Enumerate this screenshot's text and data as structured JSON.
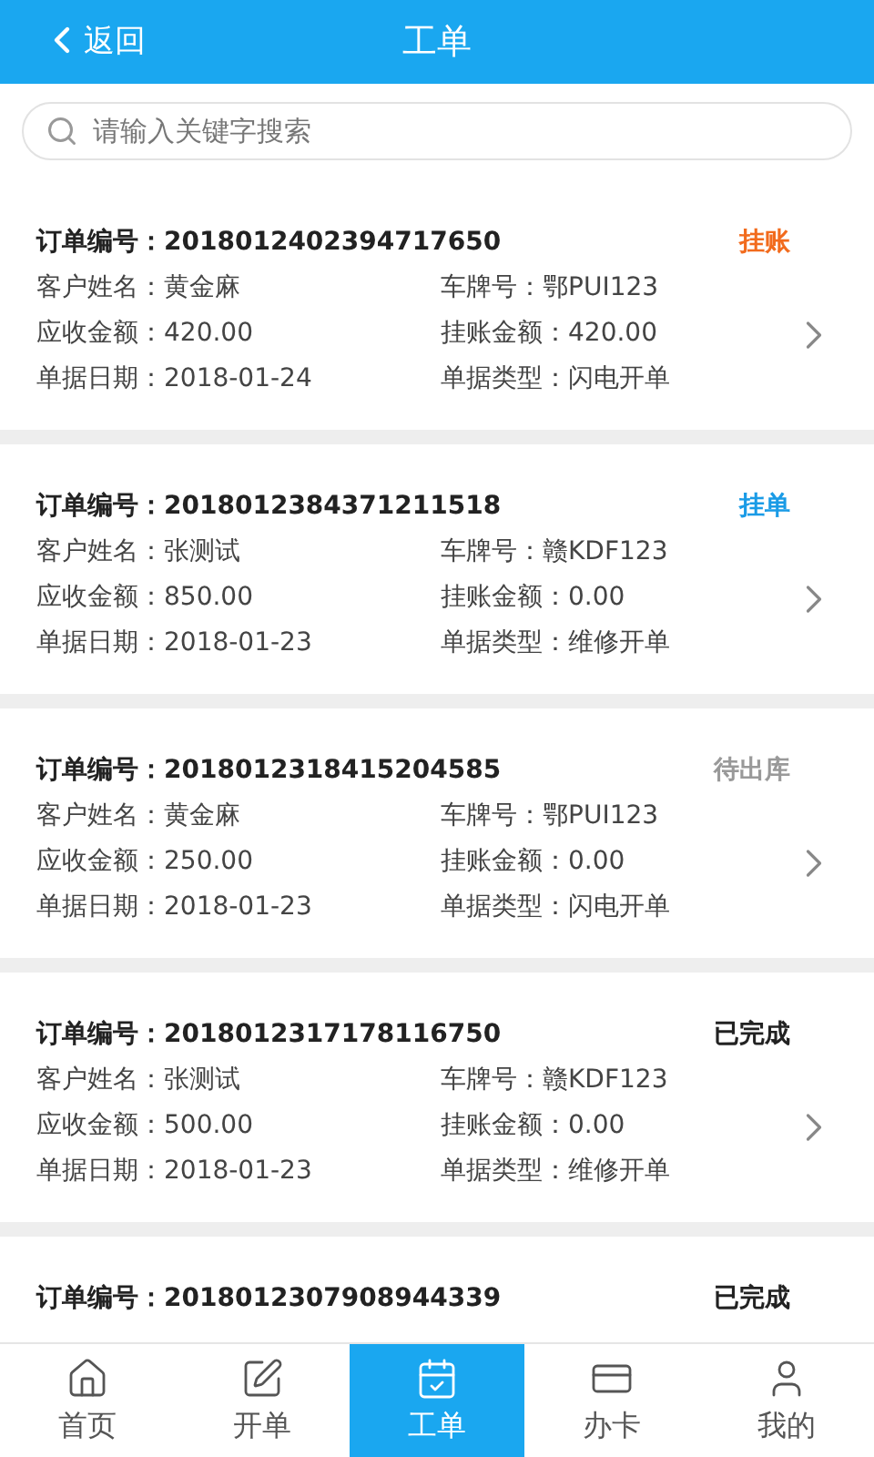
{
  "header": {
    "back": "返回",
    "title": "工单"
  },
  "search": {
    "placeholder": "请输入关键字搜索"
  },
  "orders": [
    {
      "order_label": "订单编号：",
      "order_no": "2018012402394717650",
      "status": "挂账",
      "color": "#f26b1d",
      "fields": [
        {
          "label": "客户姓名：",
          "value": "黄金麻"
        },
        {
          "label": "车牌号：",
          "value": "鄂PUI123"
        },
        {
          "label": "应收金额：",
          "value": "420.00"
        },
        {
          "label": "挂账金额：",
          "value": "420.00"
        },
        {
          "label": "单据日期：",
          "value": "2018-01-24"
        },
        {
          "label": "单据类型：",
          "value": "闪电开单"
        }
      ]
    },
    {
      "order_label": "订单编号：",
      "order_no": "2018012384371211518",
      "status": "挂单",
      "color": "#1a9be6",
      "fields": [
        {
          "label": "客户姓名：",
          "value": "张测试"
        },
        {
          "label": "车牌号：",
          "value": "赣KDF123"
        },
        {
          "label": "应收金额：",
          "value": "850.00"
        },
        {
          "label": "挂账金额：",
          "value": "0.00"
        },
        {
          "label": "单据日期：",
          "value": "2018-01-23"
        },
        {
          "label": "单据类型：",
          "value": "维修开单"
        }
      ]
    },
    {
      "order_label": "订单编号：",
      "order_no": "2018012318415204585",
      "status": "待出库",
      "color": "#999999",
      "fields": [
        {
          "label": "客户姓名：",
          "value": "黄金麻"
        },
        {
          "label": "车牌号：",
          "value": "鄂PUI123"
        },
        {
          "label": "应收金额：",
          "value": "250.00"
        },
        {
          "label": "挂账金额：",
          "value": "0.00"
        },
        {
          "label": "单据日期：",
          "value": "2018-01-23"
        },
        {
          "label": "单据类型：",
          "value": "闪电开单"
        }
      ]
    },
    {
      "order_label": "订单编号：",
      "order_no": "2018012317178116750",
      "status": "已完成",
      "color": "#222222",
      "fields": [
        {
          "label": "客户姓名：",
          "value": "张测试"
        },
        {
          "label": "车牌号：",
          "value": "赣KDF123"
        },
        {
          "label": "应收金额：",
          "value": "500.00"
        },
        {
          "label": "挂账金额：",
          "value": "0.00"
        },
        {
          "label": "单据日期：",
          "value": "2018-01-23"
        },
        {
          "label": "单据类型：",
          "value": "维修开单"
        }
      ]
    },
    {
      "order_label": "订单编号：",
      "order_no": "2018012307908944339",
      "status": "已完成",
      "color": "#222222"
    }
  ],
  "nav": [
    {
      "kind": "home",
      "label": "首页",
      "selected": false
    },
    {
      "kind": "edit",
      "label": "开单",
      "selected": false
    },
    {
      "kind": "orders",
      "label": "工单",
      "selected": true
    },
    {
      "kind": "card",
      "label": "办卡",
      "selected": false
    },
    {
      "kind": "user",
      "label": "我的",
      "selected": false
    }
  ]
}
